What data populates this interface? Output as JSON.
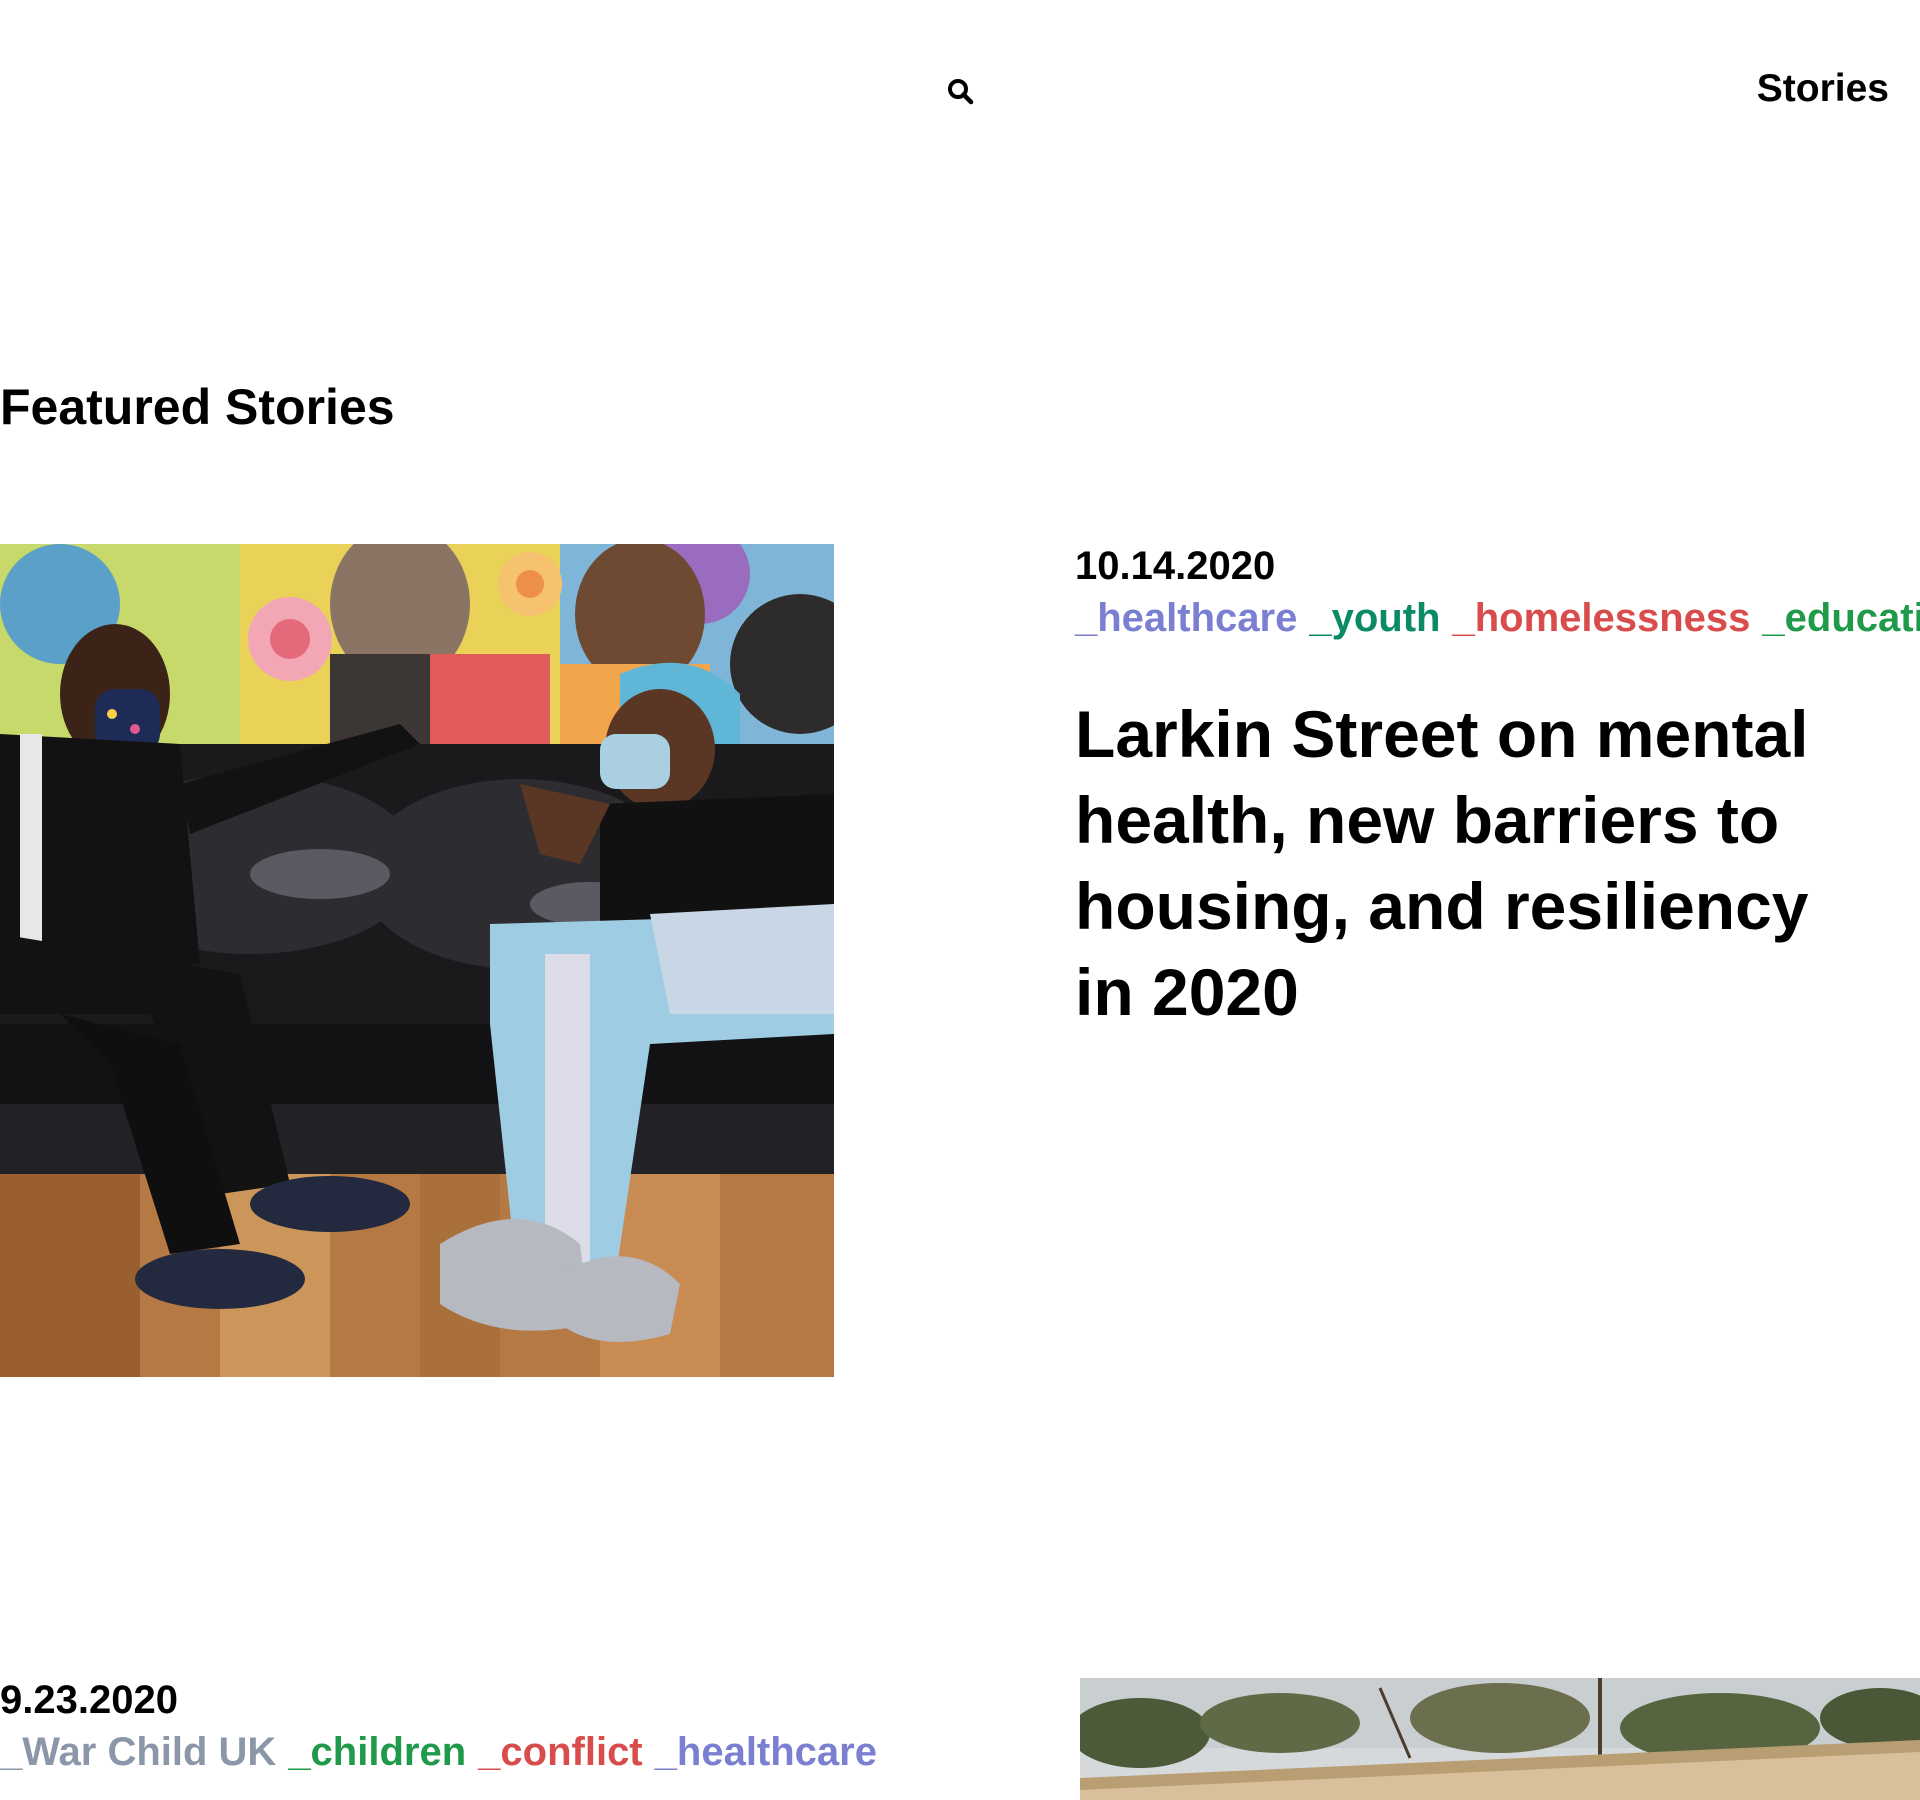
{
  "header": {
    "search_icon": "search-icon",
    "nav_stories_label": "Stories"
  },
  "main": {
    "section_title": "Featured Stories",
    "stories": [
      {
        "date": "10.14.2020",
        "tags": [
          {
            "label": "_healthcare",
            "color": "#7b7fd1"
          },
          {
            "label": "_youth",
            "color": "#0b8a66"
          },
          {
            "label": "_homelessness",
            "color": "#d94c4c"
          },
          {
            "label": "_education",
            "color": "#1f9a4a"
          }
        ],
        "title": "Larkin Street on mental health, new barriers to housing, and resiliency in 2020"
      },
      {
        "date": "9.23.2020",
        "tags": [
          {
            "label": "_War Child UK",
            "color": "#8b97a8"
          },
          {
            "label": "_children",
            "color": "#1f9a4a"
          },
          {
            "label": "_conflict",
            "color": "#d94c4c"
          },
          {
            "label": "_healthcare",
            "color": "#7b7fd1"
          }
        ]
      }
    ]
  }
}
